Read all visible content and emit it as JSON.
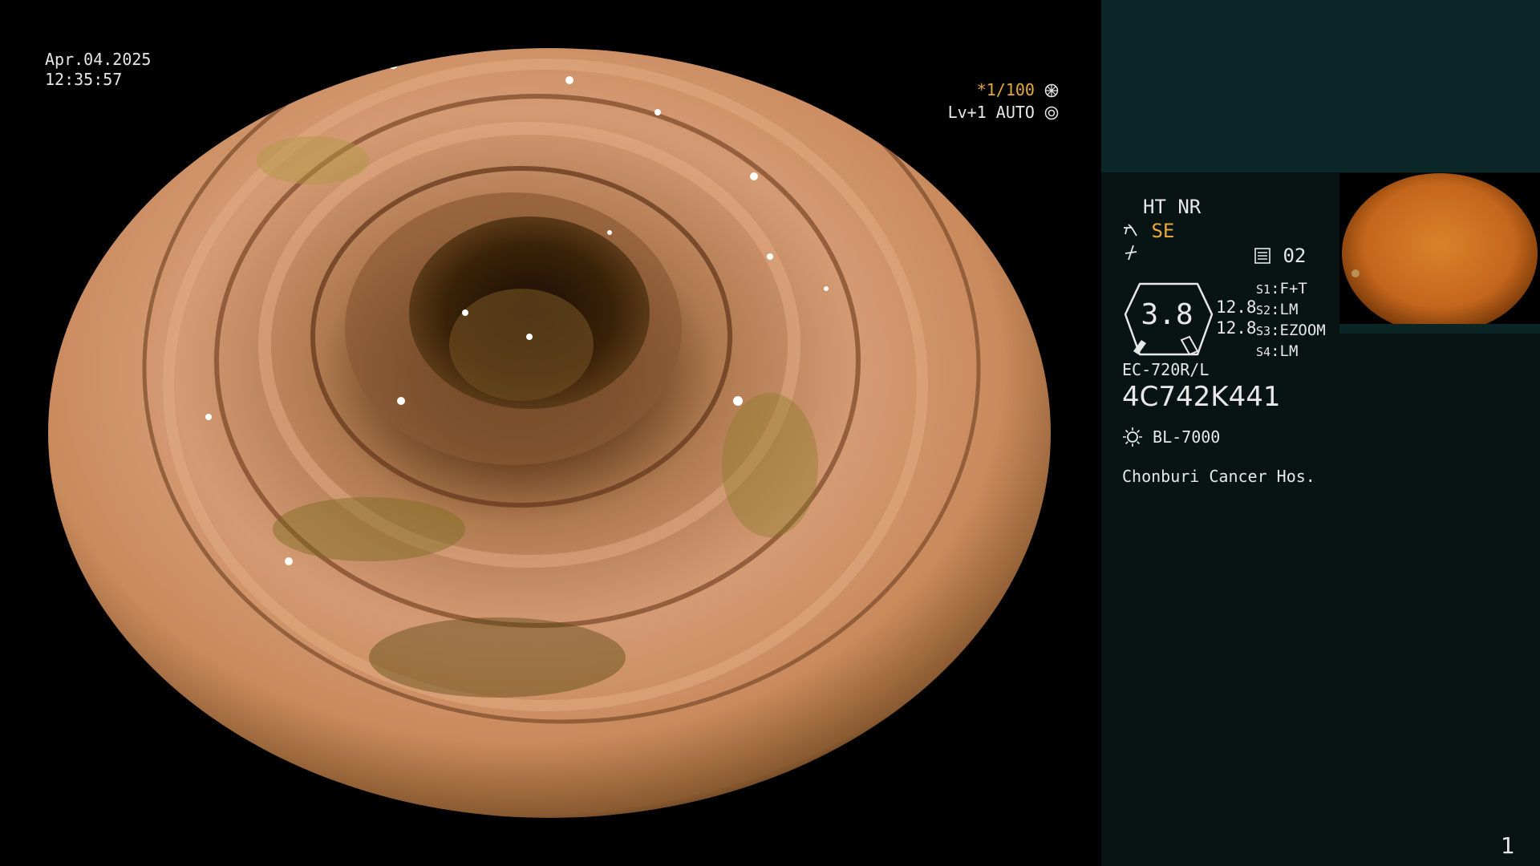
{
  "overlay": {
    "date": "Apr.04.2025",
    "time": "12:35:57",
    "shutter": "*1/100",
    "level_mode": "Lv+1 AUTO"
  },
  "panel": {
    "ht_nr": "HT NR",
    "se": "SE",
    "memo_count": "02",
    "zoom_value": "3.8",
    "sub_values": [
      "12.8",
      "12.8"
    ],
    "switches": [
      {
        "key": "S1",
        "value": "F+T"
      },
      {
        "key": "S2",
        "value": "LM"
      },
      {
        "key": "S3",
        "value": "EZOOM"
      },
      {
        "key": "S4",
        "value": "LM"
      }
    ],
    "scope_model": "EC-720R/L",
    "scope_serial": "4C742K441",
    "light_source": "BL-7000",
    "hospital": "Chonburi Cancer Hos.",
    "page_number": "1"
  },
  "icons": {
    "shutter": "aperture-icon",
    "level": "iris-icon",
    "se": "scope-tip-icon",
    "flash": "freeze-icon",
    "memo": "memory-icon",
    "light": "lamp-icon"
  },
  "colors": {
    "accent_amber": "#e8a840",
    "panel_bg": "#071413",
    "panel_header": "#0b2626"
  }
}
